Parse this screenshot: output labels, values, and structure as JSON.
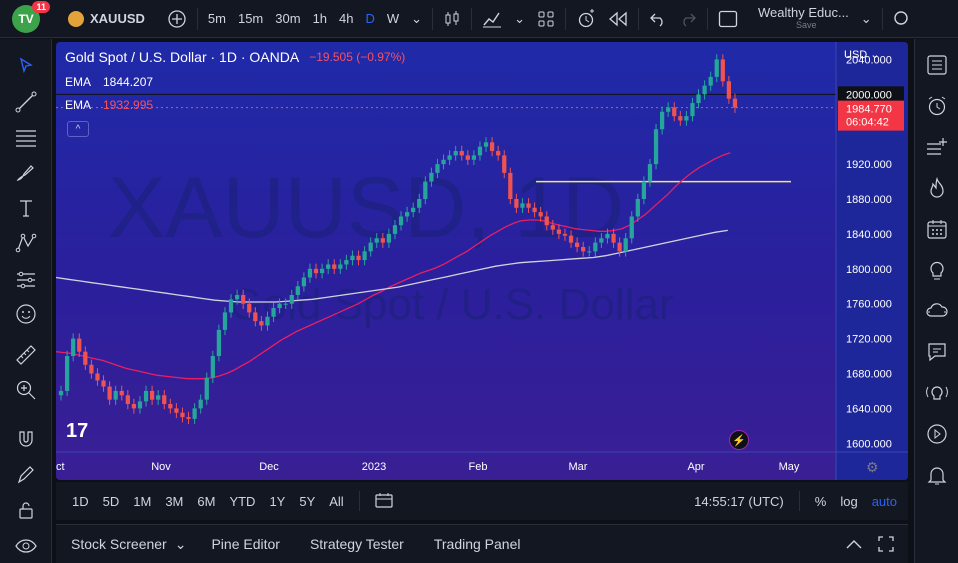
{
  "topbar": {
    "badge_count": "11",
    "symbol": "XAUUSD",
    "intervals": [
      "5m",
      "15m",
      "30m",
      "1h",
      "4h",
      "D",
      "W"
    ],
    "active_interval": "D",
    "layout_name": "Wealthy Educ...",
    "layout_sub": "Save"
  },
  "legend": {
    "title": "Gold Spot / U.S. Dollar · 1D · OANDA",
    "change": "−19.505 (−0.97%)",
    "ema1_label": "EMA",
    "ema1_value": "1844.207",
    "ema2_label": "EMA",
    "ema2_value": "1932.995"
  },
  "watermark": {
    "symbol": "XAUUSD, 1D",
    "name": "Gold Spot / U.S. Dollar"
  },
  "price_axis": {
    "currency": "USD",
    "ticks": [
      "2040.000",
      "2000.000",
      "1920.000",
      "1880.000",
      "1840.000",
      "1800.000",
      "1760.000",
      "1720.000",
      "1680.000",
      "1640.000",
      "1600.000"
    ],
    "current_price": "1984.770",
    "countdown": "06:04:42",
    "highlight": "2000.000"
  },
  "time_axis": {
    "labels": [
      "ct",
      "Nov",
      "Dec",
      "2023",
      "Feb",
      "Mar",
      "Apr",
      "May"
    ]
  },
  "rangebar": {
    "ranges": [
      "1D",
      "5D",
      "1M",
      "3M",
      "6M",
      "YTD",
      "1Y",
      "5Y",
      "All"
    ],
    "clock": "14:55:17 (UTC)",
    "percent": "%",
    "log": "log",
    "auto": "auto"
  },
  "panels": {
    "stock_screener": "Stock Screener",
    "pine_editor": "Pine Editor",
    "strategy_tester": "Strategy Tester",
    "trading_panel": "Trading Panel"
  },
  "colors": {
    "up": "#26a69a",
    "down": "#ef5350",
    "ema_fast": "#e91e63",
    "ema_slow": "#d1d4dc",
    "hline": "#f0e68c",
    "accent": "#2962ff"
  },
  "chart_data": {
    "type": "candlestick",
    "x_labels": [
      "ct",
      "Nov",
      "Dec",
      "2023",
      "Feb",
      "Mar",
      "Apr",
      "May"
    ],
    "ylim": [
      1590,
      2060
    ],
    "horizontal_lines": [
      2000,
      1900
    ],
    "current_price": 1984.77,
    "closes": [
      1660,
      1700,
      1720,
      1705,
      1690,
      1680,
      1672,
      1665,
      1650,
      1660,
      1655,
      1645,
      1640,
      1648,
      1660,
      1650,
      1655,
      1645,
      1640,
      1635,
      1630,
      1628,
      1640,
      1650,
      1675,
      1700,
      1730,
      1750,
      1765,
      1770,
      1760,
      1750,
      1740,
      1735,
      1745,
      1755,
      1760,
      1760,
      1770,
      1780,
      1790,
      1800,
      1795,
      1800,
      1805,
      1800,
      1805,
      1810,
      1815,
      1810,
      1820,
      1830,
      1835,
      1830,
      1840,
      1850,
      1860,
      1865,
      1870,
      1880,
      1900,
      1910,
      1920,
      1925,
      1930,
      1935,
      1930,
      1925,
      1930,
      1940,
      1945,
      1935,
      1930,
      1910,
      1880,
      1870,
      1875,
      1870,
      1865,
      1860,
      1850,
      1845,
      1840,
      1838,
      1830,
      1825,
      1820,
      1820,
      1830,
      1835,
      1840,
      1830,
      1820,
      1835,
      1860,
      1880,
      1900,
      1920,
      1960,
      1980,
      1985,
      1975,
      1970,
      1975,
      1990,
      2000,
      2010,
      2020,
      2040,
      2015,
      1995,
      1984.77
    ],
    "ema_fast": [
      1705,
      1704,
      1703,
      1701,
      1699,
      1697,
      1695,
      1692,
      1689,
      1686,
      1684,
      1682,
      1680,
      1678,
      1677,
      1676,
      1675,
      1674,
      1674,
      1674,
      1675,
      1677,
      1680,
      1684,
      1689,
      1694,
      1700,
      1706,
      1712,
      1718,
      1723,
      1728,
      1732,
      1736,
      1740,
      1744,
      1748,
      1752,
      1756,
      1760,
      1765,
      1770,
      1774,
      1779,
      1783,
      1787,
      1791,
      1795,
      1798,
      1801,
      1805,
      1810,
      1815,
      1820,
      1826,
      1832,
      1838,
      1843,
      1848,
      1852,
      1855,
      1856,
      1856,
      1855,
      1852,
      1850,
      1848,
      1846,
      1845,
      1844,
      1843,
      1843,
      1844,
      1846,
      1850,
      1856,
      1862,
      1870,
      1878,
      1886,
      1895,
      1903,
      1910,
      1916,
      1921,
      1926,
      1930,
      1933
    ],
    "ema_slow": [
      1790,
      1788,
      1786,
      1784,
      1782,
      1780,
      1778,
      1776,
      1774,
      1772,
      1770,
      1768,
      1766,
      1764,
      1763,
      1762,
      1762,
      1762,
      1762,
      1763,
      1764,
      1765,
      1767,
      1769,
      1771,
      1773,
      1775,
      1777,
      1779,
      1782,
      1785,
      1788,
      1791,
      1794,
      1797,
      1800,
      1803,
      1805,
      1807,
      1808,
      1809,
      1810,
      1811,
      1812,
      1813,
      1815,
      1818,
      1821,
      1824,
      1827,
      1830,
      1833,
      1836,
      1839,
      1842,
      1844
    ]
  }
}
